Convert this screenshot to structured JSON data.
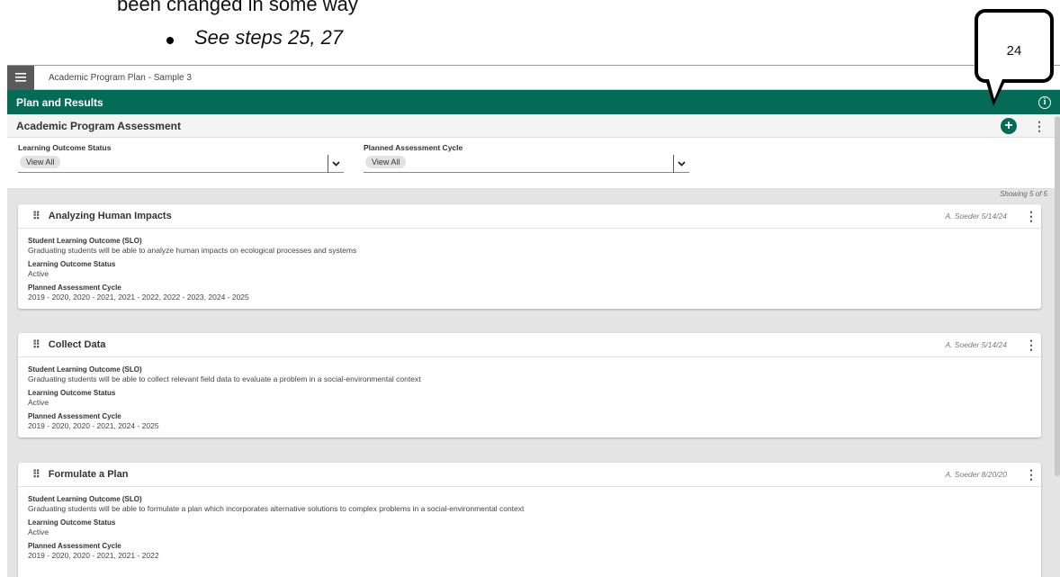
{
  "document": {
    "intro_fragment": "been changed in some way",
    "bullet_text": "See steps 25, 27",
    "callout_number": "24"
  },
  "topbar": {
    "app_title": "Academic Program Plan - Sample 3"
  },
  "greenbar": {
    "title": "Plan and Results",
    "info_glyph": "i"
  },
  "section": {
    "title": "Academic Program Assessment",
    "add_glyph": "+",
    "more_glyph": "⋮"
  },
  "filters": [
    {
      "label": "Learning Outcome Status",
      "value": "View All"
    },
    {
      "label": "Planned Assessment Cycle",
      "value": "View All"
    }
  ],
  "showing_text": "Showing 5 of 5",
  "cards": [
    {
      "title": "Analyzing Human Impacts",
      "author": "A. Soeder 5/14/24",
      "fields": [
        {
          "label": "Student Learning Outcome (SLO)",
          "value": "Graduating students will be able to analyze human impacts on ecological processes and systems"
        },
        {
          "label": "Learning Outcome Status",
          "value": "Active"
        },
        {
          "label": "Planned Assessment Cycle",
          "value": "2019 - 2020, 2020 - 2021, 2021 - 2022, 2022 - 2023, 2024 - 2025"
        }
      ]
    },
    {
      "title": "Collect Data",
      "author": "A. Soeder 5/14/24",
      "fields": [
        {
          "label": "Student Learning Outcome (SLO)",
          "value": "Graduating students will be able to collect relevant field data to evaluate a problem in a social-environmental context"
        },
        {
          "label": "Learning Outcome Status",
          "value": "Active"
        },
        {
          "label": "Planned Assessment Cycle",
          "value": "2019 - 2020, 2020 - 2021, 2024 - 2025"
        }
      ]
    },
    {
      "title": "Formulate a Plan",
      "author": "A. Soeder 8/20/20",
      "fields": [
        {
          "label": "Student Learning Outcome (SLO)",
          "value": "Graduating students will be able to formulate a plan which incorporates alternative solutions to complex problems in a social-environmental context"
        },
        {
          "label": "Learning Outcome Status",
          "value": "Active"
        },
        {
          "label": "Planned Assessment Cycle",
          "value": "2019 - 2020, 2020 - 2021, 2021 - 2022"
        }
      ]
    }
  ],
  "icons": {
    "menu": "hamburger-icon",
    "info": "info-circle-icon",
    "add": "plus-circle-icon",
    "more": "kebab-menu-icon",
    "drag": "drag-handle-icon",
    "dropdown": "chevron-down-icon"
  },
  "colors": {
    "brand_green": "#046b57",
    "menu_button": "#5a5a5a",
    "page_background": "#e4e4e4"
  }
}
